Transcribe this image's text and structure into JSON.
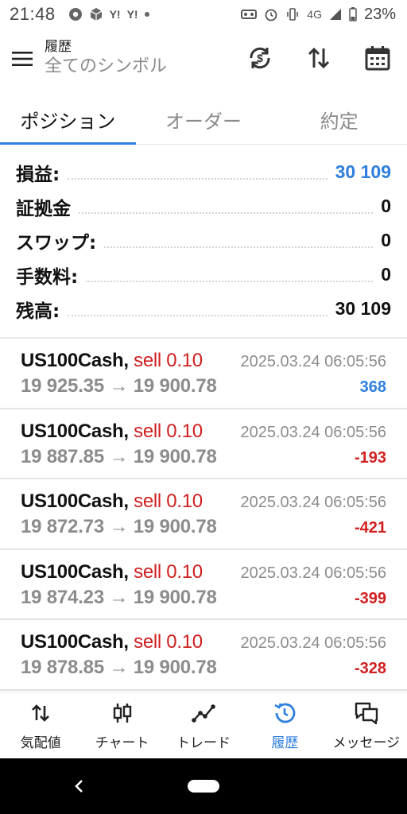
{
  "status_bar": {
    "time": "21:48",
    "network": "4G",
    "battery": "23%",
    "left_icons": [
      "chrome-icon",
      "cube-icon",
      "Y!",
      "Y!"
    ]
  },
  "header": {
    "title": "履歴",
    "subtitle": "全てのシンボル"
  },
  "tabs": [
    {
      "label": "ポジション",
      "active": true
    },
    {
      "label": "オーダー",
      "active": false
    },
    {
      "label": "約定",
      "active": false
    }
  ],
  "summary": {
    "profit_label": "損益:",
    "profit_value": "30 109",
    "margin_label": "証拠金",
    "margin_value": "0",
    "swap_label": "スワップ:",
    "swap_value": "0",
    "commission_label": "手数料:",
    "commission_value": "0",
    "balance_label": "残高:",
    "balance_value": "30 109"
  },
  "deals": [
    {
      "symbol": "US100Cash,",
      "side": "sell 0.10",
      "date": "2025.03.24 06:05:56",
      "prices": "19 925.35 → 19 900.78",
      "profit": "368",
      "profit_sign": "pos"
    },
    {
      "symbol": "US100Cash,",
      "side": "sell 0.10",
      "date": "2025.03.24 06:05:56",
      "prices": "19 887.85 → 19 900.78",
      "profit": "-193",
      "profit_sign": "neg"
    },
    {
      "symbol": "US100Cash,",
      "side": "sell 0.10",
      "date": "2025.03.24 06:05:56",
      "prices": "19 872.73 → 19 900.78",
      "profit": "-421",
      "profit_sign": "neg"
    },
    {
      "symbol": "US100Cash,",
      "side": "sell 0.10",
      "date": "2025.03.24 06:05:56",
      "prices": "19 874.23 → 19 900.78",
      "profit": "-399",
      "profit_sign": "neg"
    },
    {
      "symbol": "US100Cash,",
      "side": "sell 0.10",
      "date": "2025.03.24 06:05:56",
      "prices": "19 878.85 → 19 900.78",
      "profit": "-328",
      "profit_sign": "neg"
    }
  ],
  "bottom_nav": [
    {
      "label": "気配値",
      "icon": "quotes-icon",
      "active": false
    },
    {
      "label": "チャート",
      "icon": "candlestick-icon",
      "active": false
    },
    {
      "label": "トレード",
      "icon": "trade-icon",
      "active": false
    },
    {
      "label": "履歴",
      "icon": "history-icon",
      "active": true
    },
    {
      "label": "メッセージ",
      "icon": "messages-icon",
      "active": false
    }
  ],
  "colors": {
    "accent": "#2f7fde",
    "negative": "#d01f1f",
    "muted": "#8c8c8c"
  }
}
